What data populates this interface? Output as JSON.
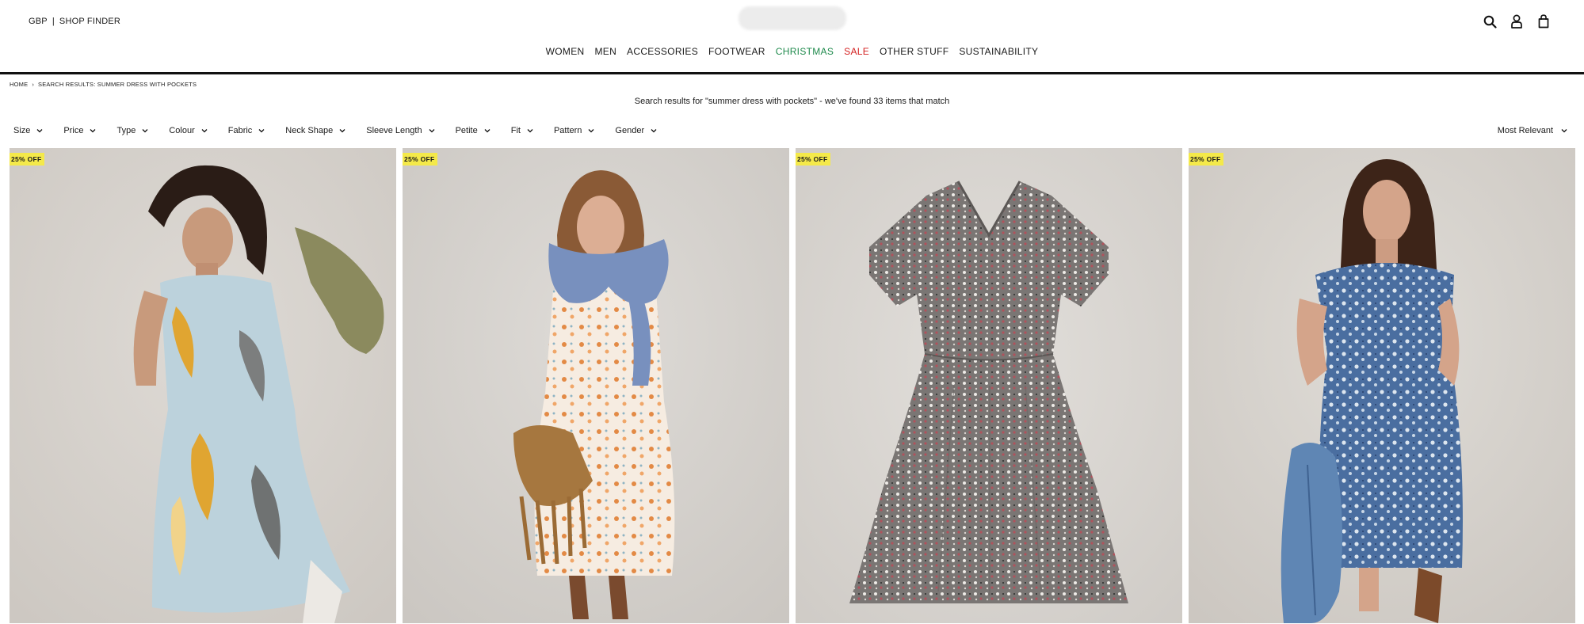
{
  "header": {
    "currency": "GBP",
    "separator": "|",
    "shop_finder": "SHOP FINDER"
  },
  "nav": [
    {
      "label": "WOMEN"
    },
    {
      "label": "MEN"
    },
    {
      "label": "ACCESSORIES"
    },
    {
      "label": "FOOTWEAR"
    },
    {
      "label": "CHRISTMAS"
    },
    {
      "label": "SALE"
    },
    {
      "label": "OTHER STUFF"
    },
    {
      "label": "SUSTAINABILITY"
    }
  ],
  "icons": [
    "search-icon",
    "account-icon",
    "bag-icon"
  ],
  "breadcrumb": {
    "home": "HOME",
    "separator": "›",
    "current": "SEARCH RESULTS: SUMMER DRESS WITH POCKETS"
  },
  "results_text": "Search results for \"summer dress with pockets\" - we've found 33 items that match",
  "filters": [
    "Size",
    "Price",
    "Type",
    "Colour",
    "Fabric",
    "Neck Shape",
    "Sleeve Length",
    "Petite",
    "Fit",
    "Pattern",
    "Gender"
  ],
  "sort": {
    "label": "Most Relevant"
  },
  "colors": {
    "christmas": "#1f8a4c",
    "sale": "#d42020",
    "badge": "#f4e94a"
  },
  "products": [
    {
      "badge": "25% OFF"
    },
    {
      "badge": "25% OFF"
    },
    {
      "badge": "25% OFF"
    },
    {
      "badge": "25% OFF"
    }
  ]
}
